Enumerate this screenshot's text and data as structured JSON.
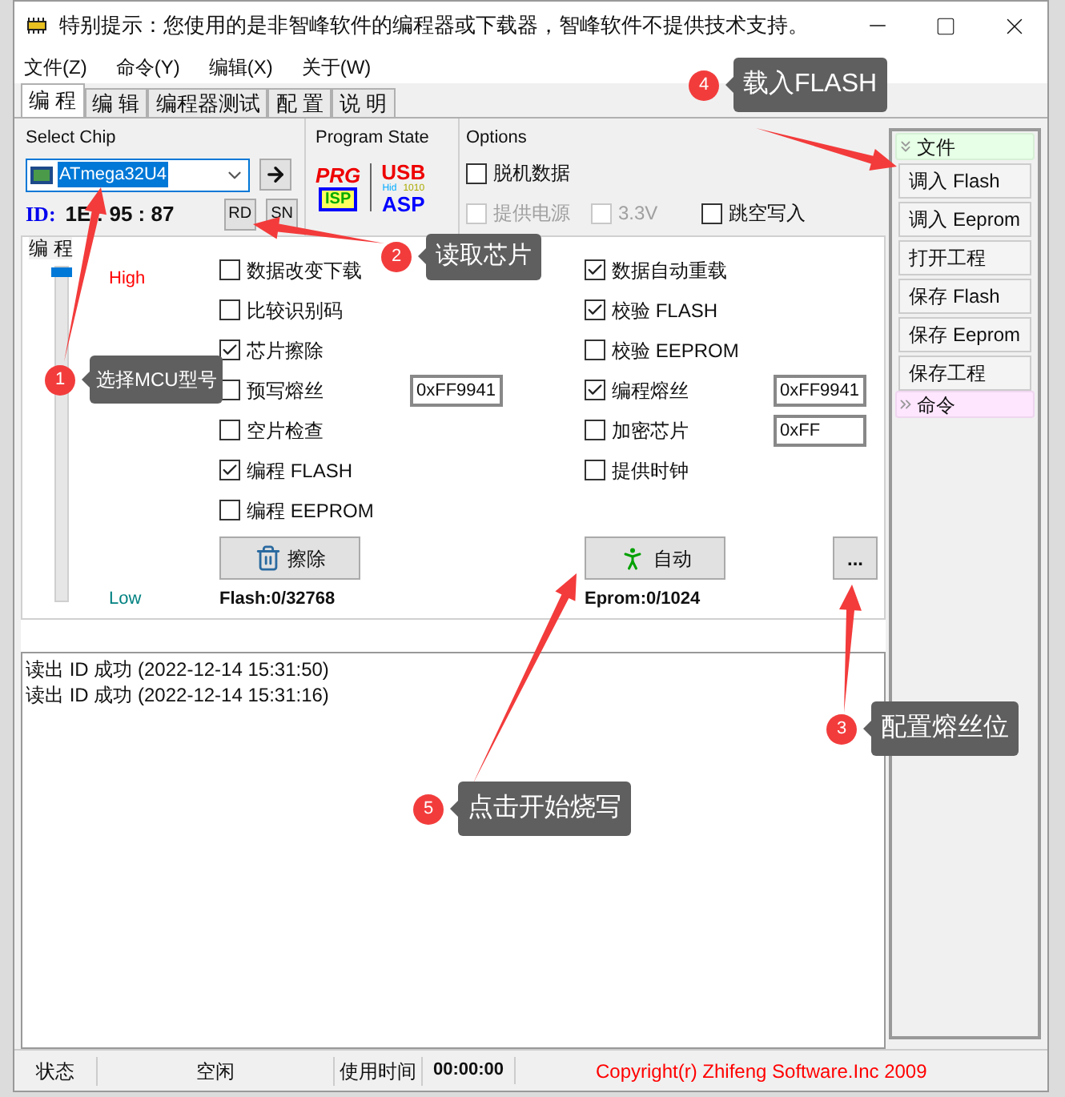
{
  "title": "特别提示：您使用的是非智峰软件的编程器或下载器，智峰软件不提供技术支持。",
  "menu": [
    "文件(Z)",
    "命令(Y)",
    "编辑(X)",
    "关于(W)"
  ],
  "tabs": [
    {
      "label": "编 程",
      "selected": true
    },
    {
      "label": "编 辑",
      "selected": false
    },
    {
      "label": "编程器测试",
      "selected": false
    },
    {
      "label": "配 置",
      "selected": false
    },
    {
      "label": "说 明",
      "selected": false
    }
  ],
  "select_chip": {
    "title": "Select Chip",
    "chip": "ATmega32U4",
    "id_label": "ID:",
    "id_value": "1E : 95 : 87",
    "buttons": [
      "RD",
      "SN"
    ]
  },
  "program_state": {
    "title": "Program State",
    "prg": "PRG",
    "isp": "ISP",
    "usb": "USB",
    "hid": "Hid",
    "bits": "1010",
    "asp": "ASP"
  },
  "options": {
    "title": "Options",
    "items": [
      {
        "label": "脱机数据",
        "checked": false,
        "disabled": false
      },
      {
        "label": "提供电源",
        "checked": false,
        "disabled": true
      },
      {
        "label": "3.3V",
        "checked": false,
        "disabled": true
      },
      {
        "label": "跳空写入",
        "checked": false,
        "disabled": false
      }
    ]
  },
  "program": {
    "title": "编 程",
    "high": "High",
    "low": "Low",
    "speed": {
      "level": 1
    },
    "left_options": [
      {
        "label": "数据改变下载",
        "checked": false
      },
      {
        "label": "比较识别码",
        "checked": false
      },
      {
        "label": "芯片擦除",
        "checked": true
      },
      {
        "label": "预写熔丝",
        "checked": false,
        "value": "0xFF9941"
      },
      {
        "label": "空片检查",
        "checked": false
      },
      {
        "label": "编程 FLASH",
        "checked": true
      },
      {
        "label": "编程 EEPROM",
        "checked": false
      }
    ],
    "right_options": [
      {
        "label": "数据自动重载",
        "checked": true
      },
      {
        "label": "校验 FLASH",
        "checked": true
      },
      {
        "label": "校验 EEPROM",
        "checked": false
      },
      {
        "label": "编程熔丝",
        "checked": true,
        "value": "0xFF9941"
      },
      {
        "label": "加密芯片",
        "checked": false,
        "value": "0xFF"
      },
      {
        "label": "提供时钟",
        "checked": false
      }
    ],
    "erase": "擦除",
    "auto": "自动",
    "more": "...",
    "flash": "Flash:0/32768",
    "eprom": "Eprom:0/1024"
  },
  "log": [
    "读出 ID 成功 (2022-12-14 15:31:50)",
    "读出 ID 成功 (2022-12-14 15:31:16)"
  ],
  "side_panel": [
    {
      "title": "文件",
      "expanded": true,
      "items": [
        "调入 Flash",
        "调入 Eeprom",
        "打开工程",
        "保存 Flash",
        "保存 Eeprom",
        "保存工程"
      ]
    },
    {
      "title": "命令",
      "expanded": false
    }
  ],
  "status_bar": {
    "label": "状态",
    "state": "空闲",
    "time_label": "使用时间",
    "time": "00:00:00",
    "copyright": "Copyright(r) Zhifeng Software.Inc 2009"
  },
  "callouts": [
    {
      "number": "1",
      "text": "选择MCU型号"
    },
    {
      "number": "2",
      "text": "读取芯片"
    },
    {
      "number": "3",
      "text": "配置熔丝位"
    },
    {
      "number": "4",
      "text": "载入FLASH"
    },
    {
      "number": "5",
      "text": "点击开始烧写"
    }
  ]
}
